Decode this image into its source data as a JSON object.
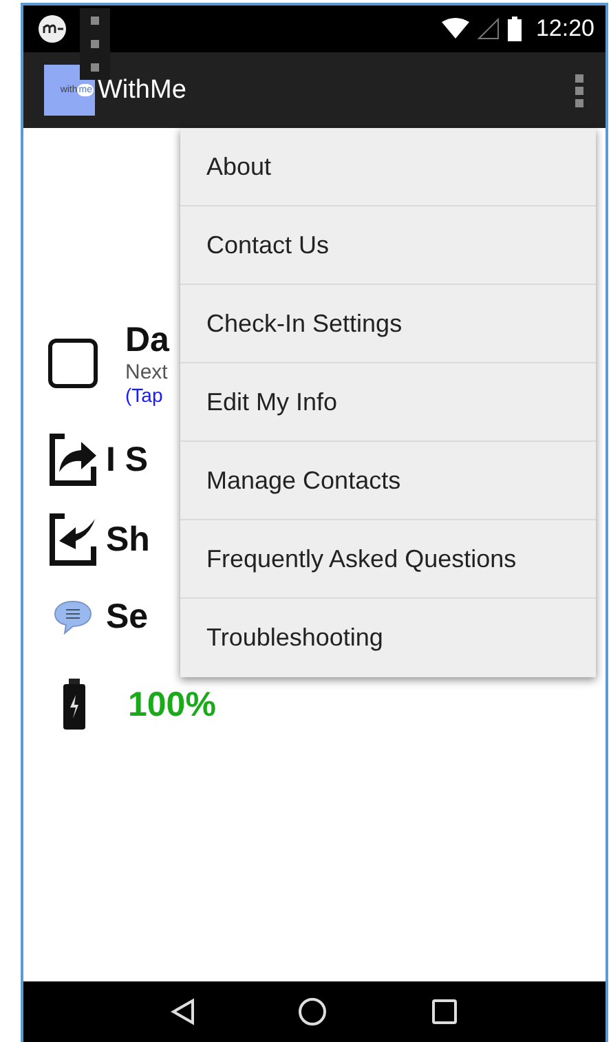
{
  "status_bar": {
    "time": "12:20"
  },
  "app_bar": {
    "title": "WithMe",
    "logo_words": [
      "with",
      "me"
    ]
  },
  "main": {
    "checkin": {
      "checked": false,
      "title": "Da",
      "subtitle": "Next",
      "hint": "(Tap"
    },
    "rows": [
      {
        "kind": "share",
        "label": "I S"
      },
      {
        "kind": "receive",
        "label": "Sh"
      },
      {
        "kind": "message",
        "label": "Se"
      }
    ],
    "battery": {
      "reading": "100%"
    }
  },
  "menu": {
    "items": [
      "About",
      "Contact Us",
      "Check-In Settings",
      "Edit My Info",
      "Manage Contacts",
      "Frequently Asked Questions",
      "Troubleshooting"
    ]
  }
}
